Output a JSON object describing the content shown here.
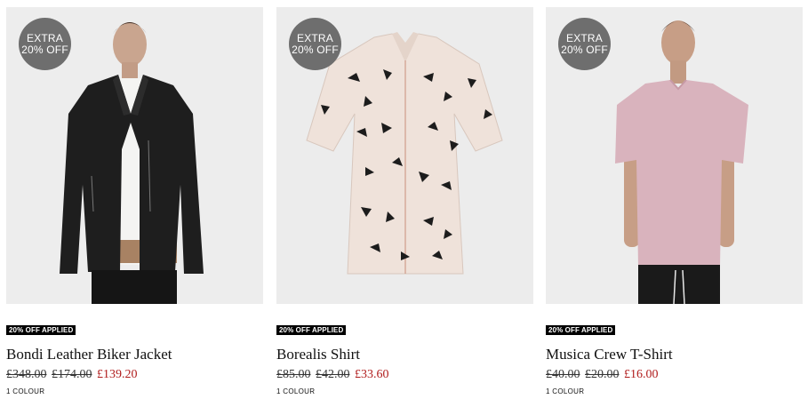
{
  "products": [
    {
      "badge_line1": "EXTRA",
      "badge_line2": "20% OFF",
      "tag": "20% OFF APPLIED",
      "name": "Bondi Leather Biker Jacket",
      "price_original": "£348.00",
      "price_previous": "£174.00",
      "price_current": "£139.20",
      "colours": "1 COLOUR"
    },
    {
      "badge_line1": "EXTRA",
      "badge_line2": "20% OFF",
      "tag": "20% OFF APPLIED",
      "name": "Borealis Shirt",
      "price_original": "£85.00",
      "price_previous": "£42.00",
      "price_current": "£33.60",
      "colours": "1 COLOUR"
    },
    {
      "badge_line1": "EXTRA",
      "badge_line2": "20% OFF",
      "tag": "20% OFF APPLIED",
      "name": "Musica Crew T-Shirt",
      "price_original": "£40.00",
      "price_previous": "£20.00",
      "price_current": "£16.00",
      "colours": "1 COLOUR"
    }
  ],
  "colors": {
    "sale_price": "#b01c1c",
    "badge": "#6e6e6e",
    "tag_bg": "#000000"
  }
}
